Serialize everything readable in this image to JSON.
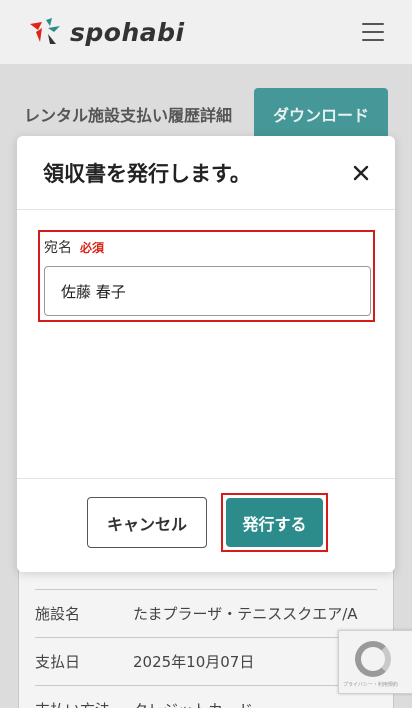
{
  "header": {
    "brand": "spohabi",
    "menu_icon": "hamburger-menu-icon",
    "logo_colors": [
      "#e2231a",
      "#2c8b8b",
      "#333333"
    ]
  },
  "page": {
    "title": "レンタル施設支払い履歴詳細",
    "download_label": "ダウンロード"
  },
  "details": {
    "rows": [
      {
        "label": "施設名",
        "value": "たまプラーザ・テニススクエア/A"
      },
      {
        "label": "支払日",
        "value": "2025年10月07日"
      },
      {
        "label": "支払い方法",
        "value": "クレジットカード"
      }
    ]
  },
  "modal": {
    "title": "領収書を発行します。",
    "close_icon": "close-icon",
    "field": {
      "label": "宛名",
      "required_label": "必須",
      "value": "佐藤 春子"
    },
    "cancel_label": "キャンセル",
    "submit_label": "発行する"
  },
  "recaptcha": {
    "text": "プライバシー・利用規約"
  },
  "colors": {
    "accent": "#2c8b8b",
    "highlight": "#d71a1a",
    "required": "#d7261a"
  }
}
